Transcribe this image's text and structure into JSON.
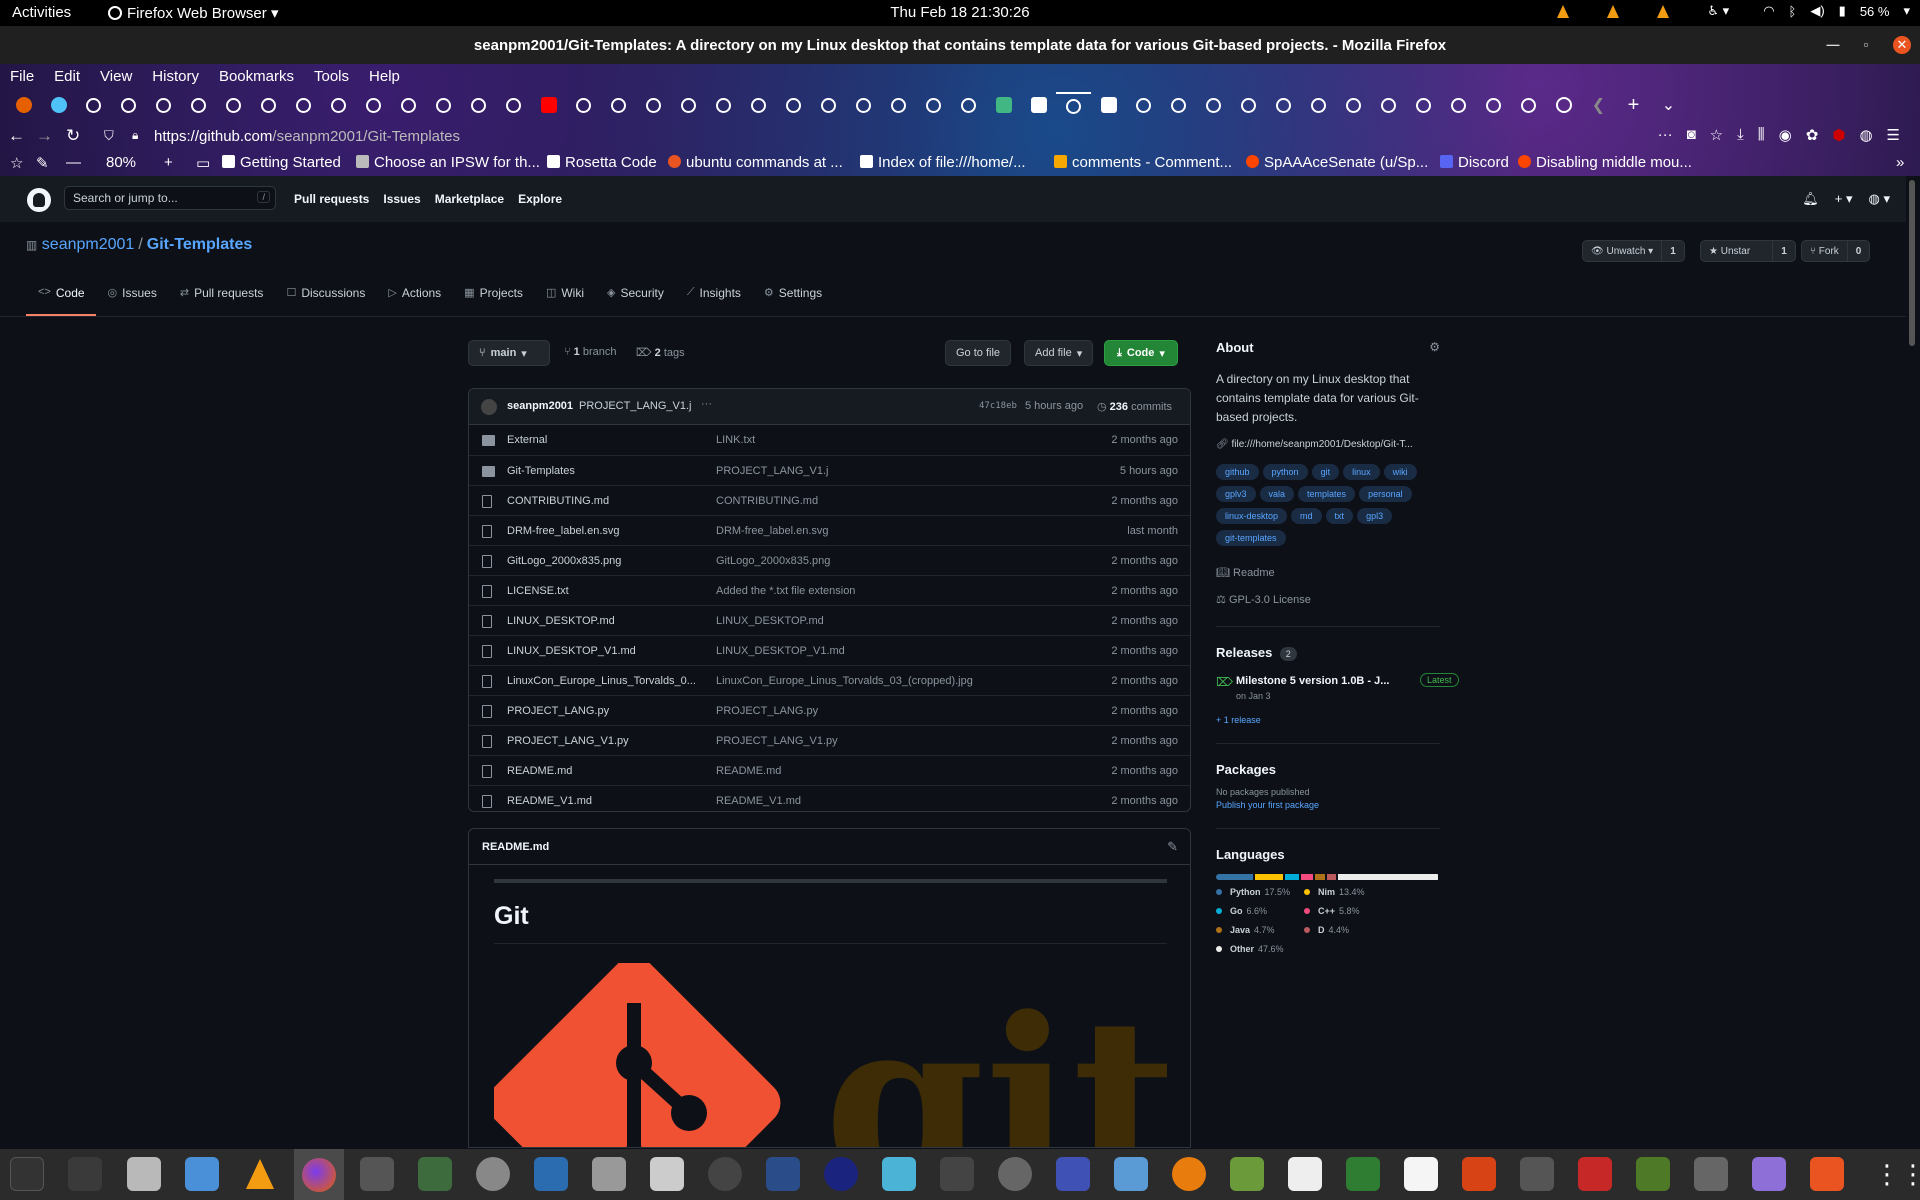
{
  "system": {
    "activities": "Activities",
    "app_menu": "Firefox Web Browser",
    "clock": "Thu Feb 18  21:30:26",
    "battery": "56 %"
  },
  "window": {
    "title": "seanpm2001/Git-Templates: A directory on my Linux desktop that contains template data for various Git-based projects. - Mozilla Firefox"
  },
  "firefox": {
    "menu": [
      "File",
      "Edit",
      "View",
      "History",
      "Bookmarks",
      "Tools",
      "Help"
    ],
    "url_domain": "https://github.com",
    "url_path": "/seanpm2001/Git-Templates",
    "zoom": "80%",
    "bookmarks": [
      "Getting Started",
      "Choose an IPSW for th...",
      "Rosetta Code",
      "ubuntu commands at ...",
      "Index of file:///home/...",
      "comments - Comment...",
      "SpAAAceSenate (u/Sp...",
      "Discord",
      "Disabling middle mou..."
    ],
    "bookmark_colors": [
      "#fff",
      "#fff",
      "#fff",
      "#e95420",
      "#fff",
      "#f7a800",
      "#ff4500",
      "#5865f2",
      "#ff4500"
    ]
  },
  "github": {
    "search_placeholder": "Search or jump to...",
    "search_kbd": "/",
    "nav": [
      "Pull requests",
      "Issues",
      "Marketplace",
      "Explore"
    ],
    "owner": "seanpm2001",
    "repo": "Git-Templates",
    "watch_label": "Unwatch",
    "watch_count": "1",
    "star_label": "Unstar",
    "star_count": "1",
    "fork_label": "Fork",
    "fork_count": "0",
    "tabs": [
      {
        "icon": "code-icon",
        "glyph": "<>",
        "label": "Code"
      },
      {
        "icon": "issue-icon",
        "glyph": "◎",
        "label": "Issues"
      },
      {
        "icon": "pull-request-icon",
        "glyph": "⇄",
        "label": "Pull requests"
      },
      {
        "icon": "discussions-icon",
        "glyph": "☐",
        "label": "Discussions"
      },
      {
        "icon": "actions-icon",
        "glyph": "▷",
        "label": "Actions"
      },
      {
        "icon": "projects-icon",
        "glyph": "▦",
        "label": "Projects"
      },
      {
        "icon": "wiki-icon",
        "glyph": "◫",
        "label": "Wiki"
      },
      {
        "icon": "security-icon",
        "glyph": "◈",
        "label": "Security"
      },
      {
        "icon": "insights-icon",
        "glyph": "⟋",
        "label": "Insights"
      },
      {
        "icon": "settings-icon",
        "glyph": "⚙",
        "label": "Settings"
      }
    ]
  },
  "filebar": {
    "branch": "main",
    "branch_count": "1",
    "branch_label": "branch",
    "tag_count": "2",
    "tag_label": "tags",
    "goto_file": "Go to file",
    "add_file": "Add file",
    "code": "Code"
  },
  "commit": {
    "author": "seanpm2001",
    "message": "PROJECT_LANG_V1.j",
    "more": "···",
    "sha": "47c18eb",
    "time": "5 hours ago",
    "count": "236",
    "count_label": "commits"
  },
  "files": [
    {
      "type": "dir",
      "name": "External",
      "msg": "LINK.txt",
      "age": "2 months ago"
    },
    {
      "type": "dir",
      "name": "Git-Templates",
      "msg": "PROJECT_LANG_V1.j",
      "age": "5 hours ago"
    },
    {
      "type": "file",
      "name": "CONTRIBUTING.md",
      "msg": "CONTRIBUTING.md",
      "age": "2 months ago"
    },
    {
      "type": "file",
      "name": "DRM-free_label.en.svg",
      "msg": "DRM-free_label.en.svg",
      "age": "last month"
    },
    {
      "type": "file",
      "name": "GitLogo_2000x835.png",
      "msg": "GitLogo_2000x835.png",
      "age": "2 months ago"
    },
    {
      "type": "file",
      "name": "LICENSE.txt",
      "msg": "Added the *.txt file extension",
      "age": "2 months ago"
    },
    {
      "type": "file",
      "name": "LINUX_DESKTOP.md",
      "msg": "LINUX_DESKTOP.md",
      "age": "2 months ago"
    },
    {
      "type": "file",
      "name": "LINUX_DESKTOP_V1.md",
      "msg": "LINUX_DESKTOP_V1.md",
      "age": "2 months ago"
    },
    {
      "type": "file",
      "name": "LinuxCon_Europe_Linus_Torvalds_0...",
      "msg": "LinuxCon_Europe_Linus_Torvalds_03_(cropped).jpg",
      "age": "2 months ago"
    },
    {
      "type": "file",
      "name": "PROJECT_LANG.py",
      "msg": "PROJECT_LANG.py",
      "age": "2 months ago"
    },
    {
      "type": "file",
      "name": "PROJECT_LANG_V1.py",
      "msg": "PROJECT_LANG_V1.py",
      "age": "2 months ago"
    },
    {
      "type": "file",
      "name": "README.md",
      "msg": "README.md",
      "age": "2 months ago"
    },
    {
      "type": "file",
      "name": "README_V1.md",
      "msg": "README_V1.md",
      "age": "2 months ago"
    }
  ],
  "readme": {
    "filename": "README.md",
    "heading": "Git",
    "logo_text": "git"
  },
  "about": {
    "title": "About",
    "description": "A directory on my Linux desktop that contains template data for various Git-based projects.",
    "link": "file:///home/seanpm2001/Desktop/Git-T...",
    "topics": [
      "github",
      "python",
      "git",
      "linux",
      "wiki",
      "gplv3",
      "vala",
      "templates",
      "personal",
      "linux-desktop",
      "md",
      "txt",
      "gpl3",
      "git-templates"
    ],
    "readme": "Readme",
    "license": "GPL-3.0 License"
  },
  "releases": {
    "title": "Releases",
    "count": "2",
    "latest_name": "Milestone 5 version 1.0B - J...",
    "latest_badge": "Latest",
    "latest_date": "on Jan 3",
    "more": "+ 1 release"
  },
  "packages": {
    "title": "Packages",
    "none": "No packages published",
    "link": "Publish your first package"
  },
  "languages": {
    "title": "Languages",
    "items": [
      {
        "name": "Python",
        "pct": "17.5%",
        "value": 17.5,
        "color": "#3572A5"
      },
      {
        "name": "Nim",
        "pct": "13.4%",
        "value": 13.4,
        "color": "#ffc200"
      },
      {
        "name": "Go",
        "pct": "6.6%",
        "value": 6.6,
        "color": "#00ADD8"
      },
      {
        "name": "C++",
        "pct": "5.8%",
        "value": 5.8,
        "color": "#f34b7d"
      },
      {
        "name": "Java",
        "pct": "4.7%",
        "value": 4.7,
        "color": "#b07219"
      },
      {
        "name": "D",
        "pct": "4.4%",
        "value": 4.4,
        "color": "#ba595e"
      },
      {
        "name": "Other",
        "pct": "47.6%",
        "value": 47.6,
        "color": "#ededed"
      }
    ]
  }
}
